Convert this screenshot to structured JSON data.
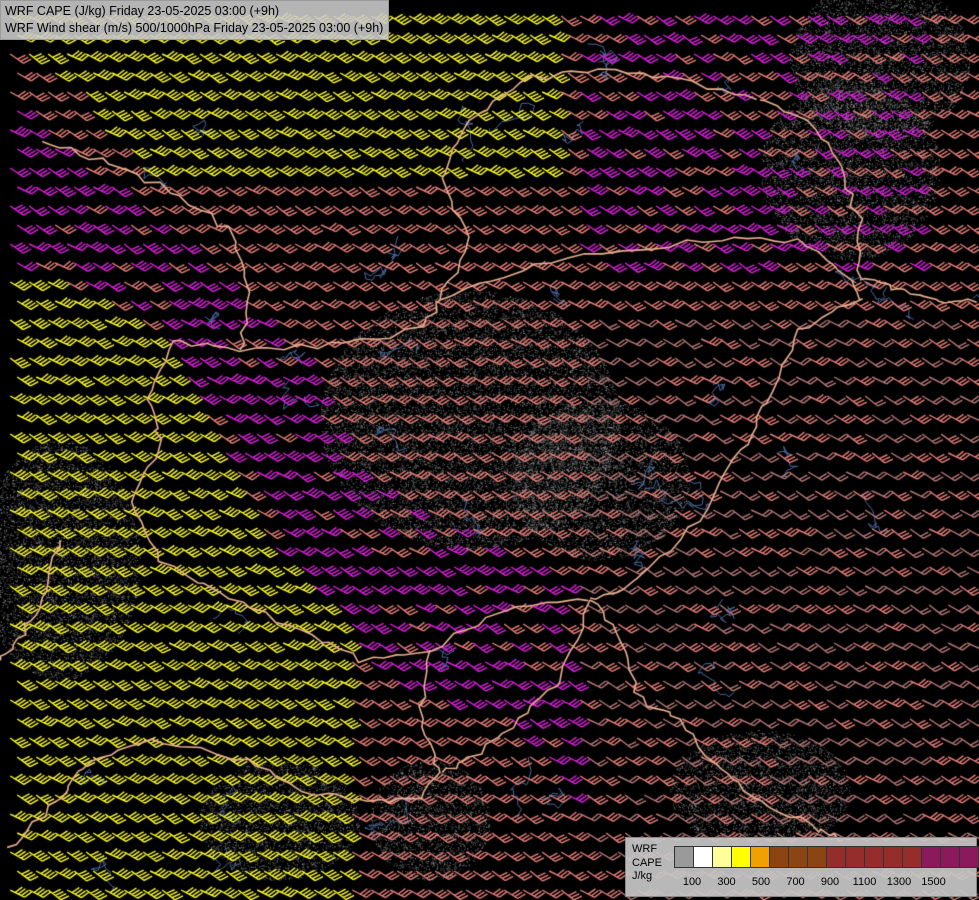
{
  "header": {
    "line1": "WRF CAPE (J/kg) Friday 23-05-2025 03:00 (+9h)",
    "line2": "WRF Wind shear (m/s) 500/1000hPa Friday 23-05-2025 03:00 (+9h)"
  },
  "legend": {
    "label_lines": [
      "WRF",
      "CAPE",
      "J/kg"
    ],
    "swatch_colors": [
      "#9a9a9a",
      "#ffffff",
      "#ffff99",
      "#ffff00",
      "#f0a000",
      "#8b4513",
      "#8b4513",
      "#8b4513",
      "#962d2d",
      "#962d2d",
      "#962d2d",
      "#962d2d",
      "#962d2d",
      "#8b1a5c",
      "#8b1a5c",
      "#8b1a5c"
    ],
    "ticks": [
      "100",
      "300",
      "500",
      "700",
      "900",
      "1100",
      "1300",
      "1500"
    ]
  },
  "map": {
    "barb_colors": {
      "yellow": "#ffff2a",
      "magenta": "#e020e0",
      "salmon": "#e8807a",
      "dusty_rose": "#b87878"
    },
    "border_color": "#e8b090",
    "river_color": "#4a6aa0",
    "terrain_stipple": "#c0c0c0"
  }
}
